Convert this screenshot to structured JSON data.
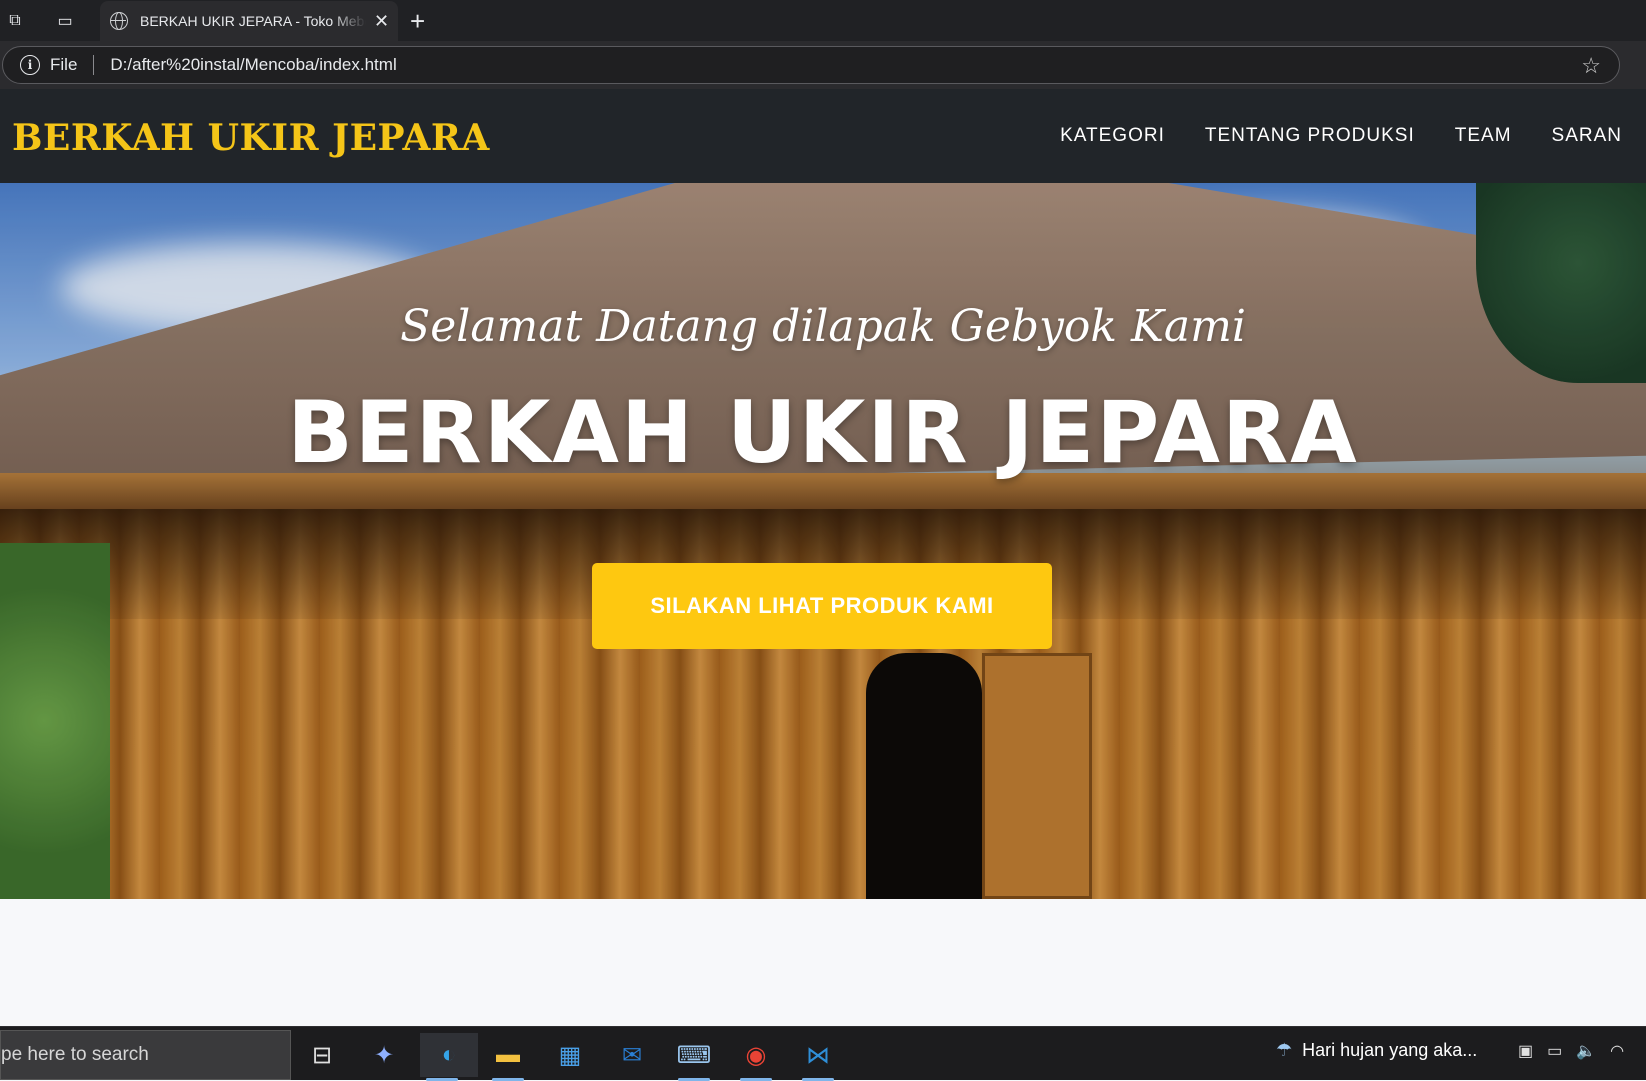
{
  "browser": {
    "tab_title": "BERKAH UKIR JEPARA - Toko Mebel",
    "address_scheme": "File",
    "address_url": "D:/after%20instal/Mencoba/index.html"
  },
  "site": {
    "brand": "BERKAH UKIR JEPARA",
    "nav": [
      "KATEGORI",
      "TENTANG PRODUKSI",
      "TEAM",
      "SARAN"
    ],
    "hero": {
      "subheading": "Selamat Datang dilapak Gebyok Kami",
      "heading": "BERKAH UKIR JEPARA",
      "cta_label": "SILAKAN LIHAT PRODUK KAMI"
    },
    "colors": {
      "brand_yellow": "#f5c518",
      "cta_yellow": "#fec810",
      "navbar_bg": "#212529"
    }
  },
  "taskbar": {
    "search_placeholder": "pe here to search",
    "weather_text": "Hari hujan yang aka...",
    "apps": [
      "task-view-icon",
      "copilot-icon",
      "edge-icon",
      "file-explorer-icon",
      "store-icon",
      "outlook-icon",
      "keyboard-app-icon",
      "chrome-icon",
      "vscode-icon"
    ]
  }
}
